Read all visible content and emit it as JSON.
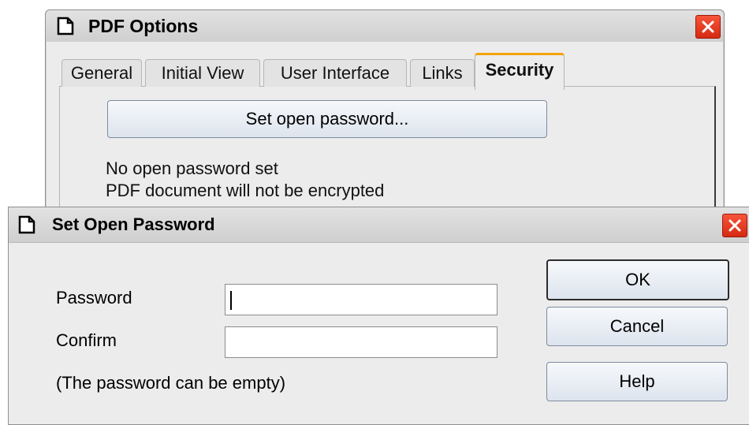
{
  "pdf_options": {
    "title": "PDF Options",
    "tabs": [
      {
        "label": "General"
      },
      {
        "label": "Initial View"
      },
      {
        "label": "User Interface"
      },
      {
        "label": "Links"
      },
      {
        "label": "Security"
      }
    ],
    "set_open_password_button": "Set open password...",
    "status_line1": "No open password set",
    "status_line2": "PDF document will not be encrypted"
  },
  "set_open_password_dialog": {
    "title": "Set Open Password",
    "password_label": "Password",
    "confirm_label": "Confirm",
    "password_value": "",
    "confirm_value": "",
    "hint": "(The password can be empty)",
    "ok_label": "OK",
    "cancel_label": "Cancel",
    "help_label": "Help"
  },
  "colors": {
    "close_button": "#e0381c",
    "active_tab_accent": "#f4a300"
  }
}
